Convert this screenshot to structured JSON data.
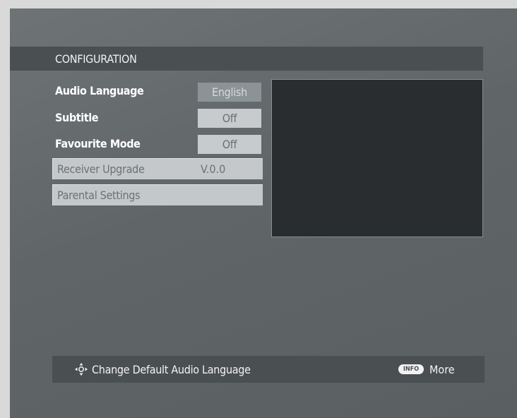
{
  "screen": {
    "title": "CONFIGURATION"
  },
  "menu": {
    "audio_language": {
      "label": "Audio Language",
      "value": "English"
    },
    "subtitle": {
      "label": "Subtitle",
      "value": "Off"
    },
    "favourite_mode": {
      "label": "Favourite Mode",
      "value": "Off"
    },
    "receiver_upgrade": {
      "label": "Receiver Upgrade",
      "value": "V.0.0"
    },
    "parental_settings": {
      "label": "Parental Settings"
    }
  },
  "help": {
    "hint": "Change Default Audio Language",
    "info_key": "INFO",
    "more": "More",
    "nav_icon": "dpad-arrows-icon"
  },
  "colors": {
    "background": "#606668",
    "bar": "#4a4f52",
    "selected_value": "#8c9396",
    "preview": "#2a2d2f"
  }
}
